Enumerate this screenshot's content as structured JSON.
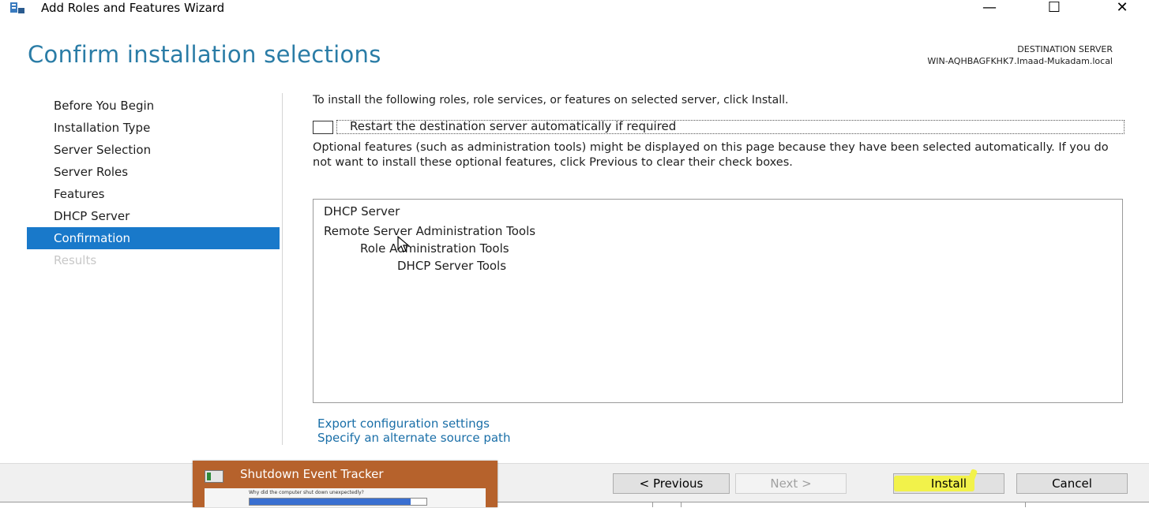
{
  "window": {
    "title": "Add Roles and Features Wizard",
    "minimize_glyph": "—",
    "maximize_glyph": "☐",
    "close_glyph": "✕"
  },
  "page": {
    "title": "Confirm installation selections",
    "destination_label": "DESTINATION SERVER",
    "destination_server": "WIN-AQHBAGFKHK7.Imaad-Mukadam.local"
  },
  "nav": {
    "items": [
      {
        "label": "Before You Begin",
        "state": "normal"
      },
      {
        "label": "Installation Type",
        "state": "normal"
      },
      {
        "label": "Server Selection",
        "state": "normal"
      },
      {
        "label": "Server Roles",
        "state": "normal"
      },
      {
        "label": "Features",
        "state": "normal"
      },
      {
        "label": "DHCP Server",
        "state": "normal"
      },
      {
        "label": "Confirmation",
        "state": "active"
      },
      {
        "label": "Results",
        "state": "disabled"
      }
    ]
  },
  "content": {
    "intro": "To install the following roles, role services, or features on selected server, click Install.",
    "restart_label": "Restart the destination server automatically if required",
    "restart_checked": false,
    "optional_text": "Optional features (such as administration tools) might be displayed on this page because they have been selected automatically. If you do not want to install these optional features, click Previous to clear their check boxes.",
    "features": [
      "DHCP Server",
      "Remote Server Administration Tools",
      "Role Administration Tools",
      "DHCP Server Tools"
    ],
    "links": {
      "export": "Export configuration settings",
      "alternate_source": "Specify an alternate source path"
    }
  },
  "buttons": {
    "previous": "< Previous",
    "next": "Next >",
    "install": "Install",
    "cancel": "Cancel"
  },
  "shutdown_tracker": {
    "title": "Shutdown Event Tracker",
    "question": "Why did the computer shut down unexpectedly?"
  },
  "colors": {
    "accent": "#1979ca",
    "title_blue": "#2a7ca6",
    "link": "#1a6fa8",
    "highlight": "#f2f24a",
    "tracker_bg": "#b6622c"
  }
}
